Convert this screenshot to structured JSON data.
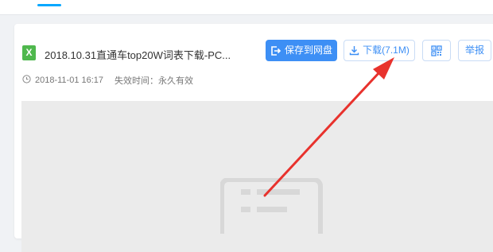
{
  "file": {
    "icon_letter": "X",
    "name": "2018.10.31直通车top20W词表下载-PC...",
    "date": "2018-11-01 16:17",
    "expiry_label": "失效时间：",
    "expiry_value": "永久有效"
  },
  "toolbar": {
    "save_label": "保存到网盘",
    "download_label": "下载(7.1M)",
    "report_label": "举报"
  },
  "icons": {
    "file": "excel-file-icon",
    "save": "save-to-disk-icon",
    "download": "download-icon",
    "qr": "qr-code-icon",
    "clock": "clock-icon",
    "preview": "document-preview-icon"
  },
  "colors": {
    "primary": "#3d8ff5",
    "file_icon": "#4fb84d",
    "arrow": "#e8322d"
  }
}
